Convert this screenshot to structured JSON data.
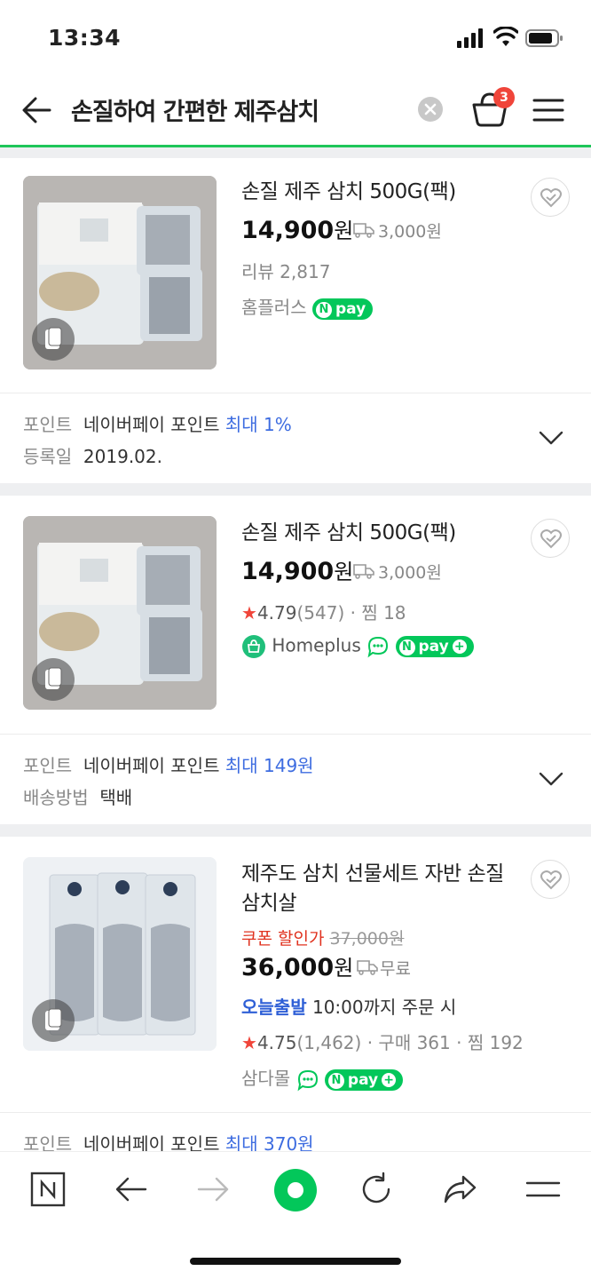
{
  "status": {
    "time": "13:34"
  },
  "header": {
    "title": "손질하여 간편한 제주삼치",
    "cart_count": "3"
  },
  "items": [
    {
      "name": "손질 제주 삼치 500G(팩)",
      "price": "14,900",
      "won": "원",
      "shipping": "3,000원",
      "review": "리뷰 2,817",
      "seller": "홈플러스",
      "npay": "pay",
      "point_label": "포인트",
      "point_text": "네이버페이 포인트",
      "point_max": "최대 1%",
      "second_label": "등록일",
      "second_value": "2019.02."
    },
    {
      "name": "손질 제주 삼치 500G(팩)",
      "price": "14,900",
      "won": "원",
      "shipping": "3,000원",
      "star": "★",
      "rating": "4.79",
      "rating_count": "(547)",
      "zzim": "찜 18",
      "seller": "Homeplus",
      "npay": "pay",
      "point_label": "포인트",
      "point_text": "네이버페이 포인트",
      "point_max": "최대 149원",
      "second_label": "배송방법",
      "second_value": "택배"
    },
    {
      "name": "제주도 삼치 선물세트 자반 손질 삼치살",
      "coupon_label": "쿠폰 할인가",
      "orig_price": "37,000원",
      "price": "36,000",
      "won": "원",
      "shipping": "무료",
      "today": "오늘출발",
      "today_note": "10:00까지 주문 시",
      "star": "★",
      "rating": "4.75",
      "rating_count": "(1,462)",
      "purchase": "구매 361",
      "zzim": "찜 192",
      "seller": "삼다몰",
      "npay": "pay",
      "point_label": "포인트",
      "point_text": "네이버페이 포인트",
      "point_max": "최대 370원"
    }
  ],
  "colors": {
    "accent": "#1fc65a",
    "npay": "#03c75a",
    "badge": "#f0453a",
    "link": "#3d6ce0"
  },
  "bottom_nav": [
    "naver-home-icon",
    "back-icon",
    "forward-icon",
    "green-dot-icon",
    "refresh-icon",
    "share-icon",
    "menu-icon"
  ]
}
